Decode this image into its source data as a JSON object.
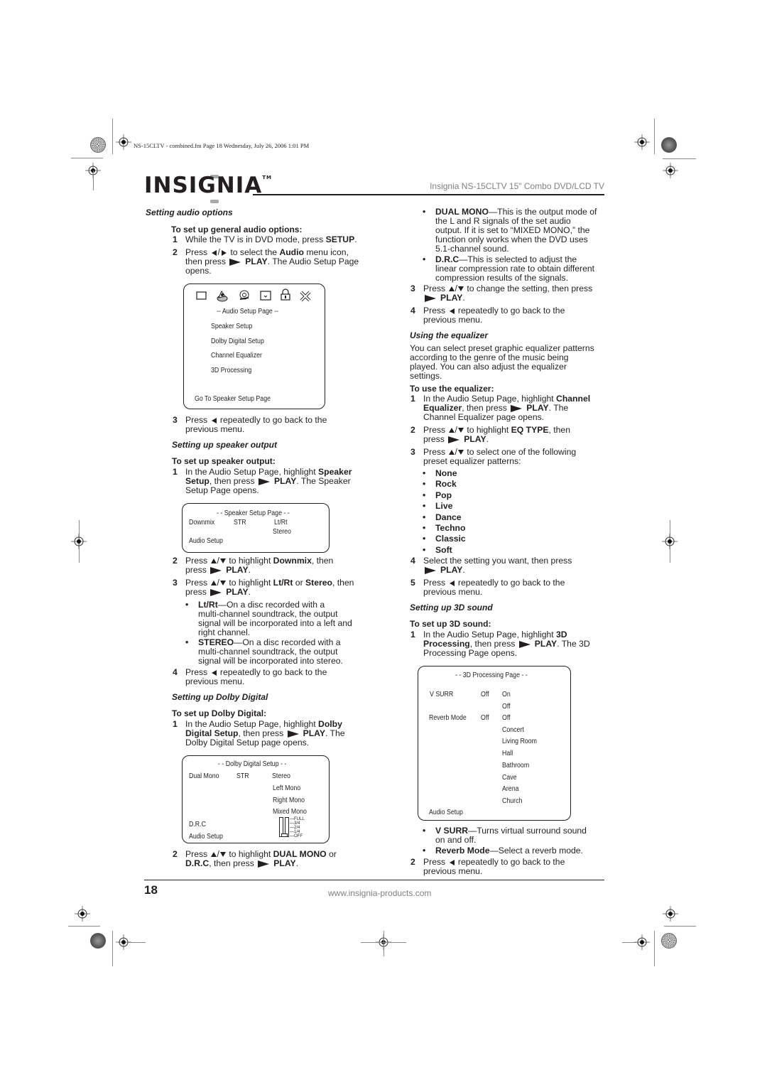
{
  "print_info": "NS-15CLTV - combined.fm  Page 18  Wednesday, July 26, 2006  1:01 PM",
  "header": {
    "logo": "INSIGNIA",
    "logo_tm": "TM",
    "title": "Insignia NS-15CLTV 15\" Combo DVD/LCD TV"
  },
  "left": {
    "audio_options": {
      "heading": "Setting audio options",
      "proc_heading": "To set up general audio options:",
      "step1_num": "1",
      "step1_a": "While the TV is in DVD mode, press ",
      "step1_b": "SETUP",
      "step1_c": ".",
      "step2_num": "2",
      "step2_a": "Press ",
      "step2_b": " to select the ",
      "step2_c": "Audio",
      "step2_d": " menu icon,",
      "step2_e": "then press ",
      "step2_f": "PLAY",
      "step2_g": ". The Audio Setup Page",
      "step2_h": "opens.",
      "screen": {
        "title": "-- Audio Setup Page --",
        "items": [
          "Speaker Setup",
          "Dolby Digital Setup",
          "Channel Equalizer",
          "3D Processing"
        ],
        "footer": "Go To Speaker Setup Page",
        "icons": [
          "tv-icon",
          "audio-speaker-icon",
          "video-reel-icon",
          "preferences-screen-icon",
          "lock-icon",
          "exit-x-icon"
        ]
      },
      "step3_num": "3",
      "step3_a": "Press ",
      "step3_b": " repeatedly to go back to the",
      "step3_c": "previous menu."
    },
    "speaker_output": {
      "heading": "Setting up speaker output",
      "proc_heading": "To set up speaker output:",
      "step1_num": "1",
      "step1_a": "In the Audio Setup Page, highlight ",
      "step1_b": "Speaker",
      "step1_c": "Setup",
      "step1_d": ", then press ",
      "step1_e": "PLAY",
      "step1_f": ". The Speaker",
      "step1_g": "Setup Page opens.",
      "screen": {
        "title": "- - Speaker Setup Page - -",
        "label": "Downmix",
        "current": "STR",
        "options": [
          "Lt/Rt",
          "Stereo"
        ],
        "footer": "Audio Setup"
      },
      "step2_num": "2",
      "step2_a": "Press ",
      "step2_b": " to highlight ",
      "step2_c": "Downmix",
      "step2_d": ", then",
      "step2_e": "press ",
      "step2_f": "PLAY",
      "step2_g": ".",
      "step3_num": "3",
      "step3_a": "Press ",
      "step3_b": " to highlight ",
      "step3_c": "Lt/Rt",
      "step3_d": " or ",
      "step3_e": "Stereo",
      "step3_f": ", then",
      "step3_g": "press ",
      "step3_h": "PLAY",
      "step3_i": ".",
      "bullet1_term": "Lt/Rt",
      "bullet1_lines": [
        "—On a disc recorded with a",
        "multi-channel soundtrack, the output",
        "signal will be incorporated into a left and",
        "right channel."
      ],
      "bullet2_term": "STEREO",
      "bullet2_lines": [
        "—On a disc recorded with a",
        "multi-channel soundtrack, the output",
        "signal will be incorporated into stereo."
      ],
      "step4_num": "4",
      "step4_a": "Press ",
      "step4_b": " repeatedly to go back to the",
      "step4_c": "previous menu."
    },
    "dolby": {
      "heading": "Setting up Dolby Digital",
      "proc_heading": "To set up Dolby Digital:",
      "step1_num": "1",
      "step1_a": "In the Audio Setup Page, highlight ",
      "step1_b": "Dolby",
      "step1_c": "Digital Setup",
      "step1_d": ", then press ",
      "step1_e": "PLAY",
      "step1_f": ". The",
      "step1_g": "Dolby Digital Setup page opens.",
      "screen": {
        "title": "- - Dolby Digital Setup  - -",
        "label1": "Dual Mono",
        "current1": "STR",
        "options1": [
          "Stereo",
          "Left Mono",
          "Right Mono",
          "Mixed Mono"
        ],
        "label2": "D.R.C",
        "slider_labels": [
          "FULL",
          "3/4",
          "2/4",
          "1/4",
          "OFF"
        ],
        "slider_value": "OFF",
        "footer": "Audio Setup"
      },
      "step2_num": "2",
      "step2_a": "Press ",
      "step2_b": " to highlight ",
      "step2_c": "DUAL MONO",
      "step2_d": " or",
      "step2_e": "D.R.C",
      "step2_f": ", then press ",
      "step2_g": "PLAY",
      "step2_h": "."
    }
  },
  "right": {
    "bullet_dual_term": "DUAL MONO",
    "bullet_dual_lines": [
      "—This is the output mode of",
      "the L and R signals of the set audio",
      "output. If it is set to “MIXED MONO,” the",
      "function only works when the DVD uses",
      "5.1-channel sound."
    ],
    "bullet_drc_term": "D.R.C",
    "bullet_drc_lines": [
      "—This is selected to adjust the",
      "linear compression rate to obtain different",
      "compression results of the signals."
    ],
    "step3_num": "3",
    "step3_a": "Press ",
    "step3_b": " to change the setting, then press",
    "step3_c": "PLAY",
    "step3_d": ".",
    "step4_num": "4",
    "step4_a": "Press ",
    "step4_b": " repeatedly to go back to the",
    "step4_c": "previous menu.",
    "equalizer": {
      "heading": "Using the equalizer",
      "intro": [
        "You can select preset graphic equalizer patterns",
        "according to the genre of the music being",
        "played. You can also adjust the equalizer",
        "settings."
      ],
      "proc_heading": "To use the equalizer:",
      "step1_num": "1",
      "step1_a": "In the Audio Setup Page, highlight ",
      "step1_b": "Channel",
      "step1_c": "Equalizer",
      "step1_d": ", then press ",
      "step1_e": "PLAY",
      "step1_f": ". The",
      "step1_g": "Channel Equalizer page opens.",
      "step2_num": "2",
      "step2_a": "Press ",
      "step2_b": " to highlight ",
      "step2_c": "EQ TYPE",
      "step2_d": ", then",
      "step2_e": "press ",
      "step2_f": "PLAY",
      "step2_g": ".",
      "step3_num": "3",
      "step3_a": "Press ",
      "step3_b": " to select one of the following",
      "step3_c": "preset equalizer patterns:",
      "patterns": [
        "None",
        "Rock",
        "Pop",
        "Live",
        "Dance",
        "Techno",
        "Classic",
        "Soft"
      ],
      "step4_num": "4",
      "step4_a": "Select the setting you want, then press",
      "step4_b": "PLAY",
      "step4_c": ".",
      "step5_num": "5",
      "step5_a": "Press ",
      "step5_b": " repeatedly to go back to the",
      "step5_c": "previous menu."
    },
    "sound3d": {
      "heading": "Setting up 3D sound",
      "proc_heading": "To set up 3D sound:",
      "step1_num": "1",
      "step1_a": "In the Audio Setup Page, highlight ",
      "step1_b": "3D",
      "step1_c": "Processing",
      "step1_d": ", then press ",
      "step1_e": "PLAY",
      "step1_f": ". The 3D",
      "step1_g": "Processing Page opens.",
      "screen": {
        "title": "- - 3D Processing Page - -",
        "label1": "V SURR",
        "current1": "Off",
        "options1": [
          "On",
          "Off"
        ],
        "label2": "Reverb Mode",
        "current2": "Off",
        "options2": [
          "Off",
          "Concert",
          "Living Room",
          "Hall",
          "Bathroom",
          "Cave",
          "Arena",
          "Church"
        ],
        "footer": "Audio Setup"
      },
      "bullet1_term": "V SURR",
      "bullet1_a": "—Turns virtual surround sound",
      "bullet1_b": "on and off.",
      "bullet2_term": "Reverb Mode",
      "bullet2_a": "—Select a reverb mode.",
      "step2_num": "2",
      "step2_a": "Press ",
      "step2_b": " repeatedly to go back to the",
      "step2_c": "previous menu."
    }
  },
  "footer": {
    "page_number": "18",
    "website": "www.insignia-products.com"
  }
}
